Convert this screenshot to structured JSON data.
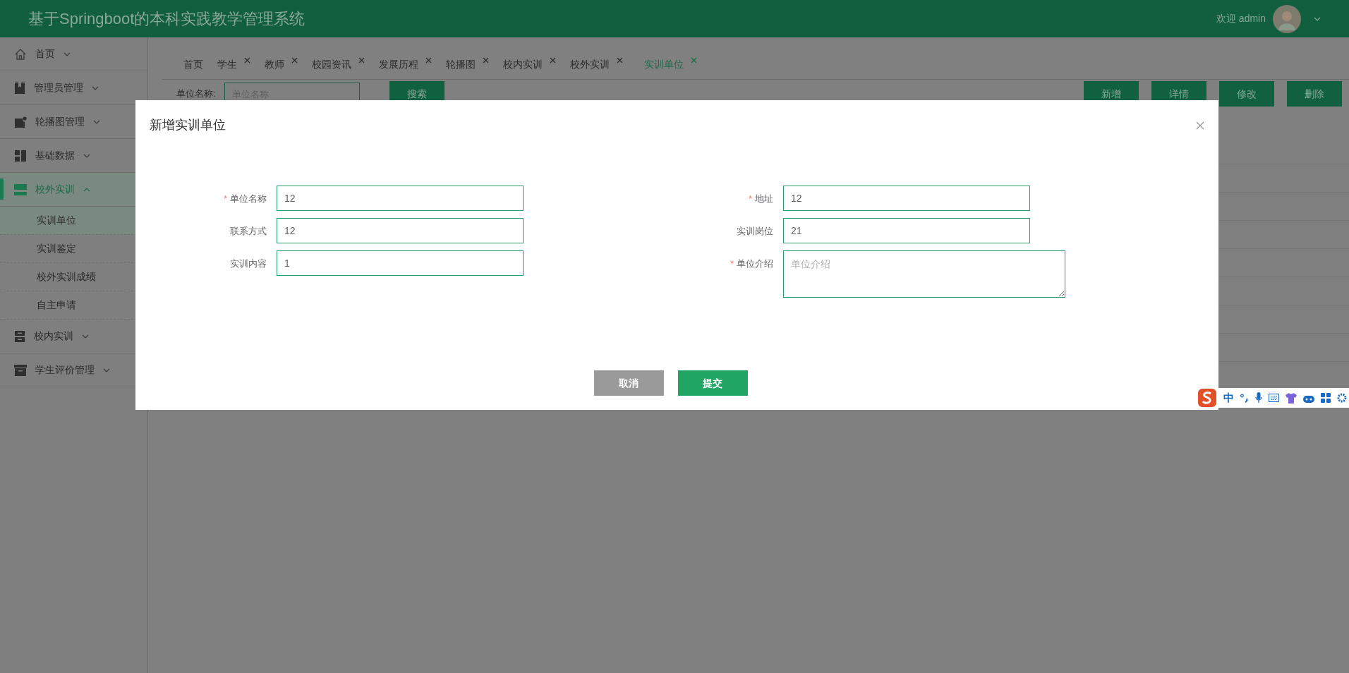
{
  "header": {
    "title": "基于Springboot的本科实践教学管理系统",
    "welcome": "欢迎 admin"
  },
  "sidebar": {
    "items": [
      {
        "label": "首页",
        "expanded": false,
        "selected": false
      },
      {
        "label": "管理员管理",
        "expanded": false,
        "selected": false
      },
      {
        "label": "轮播图管理",
        "expanded": false,
        "selected": false
      },
      {
        "label": "基础数据",
        "expanded": false,
        "selected": false
      },
      {
        "label": "校外实训",
        "expanded": true,
        "selected": true,
        "children": [
          {
            "label": "实训单位",
            "selected": true
          },
          {
            "label": "实训鉴定",
            "selected": false
          },
          {
            "label": "校外实训成绩",
            "selected": false
          },
          {
            "label": "自主申请",
            "selected": false
          }
        ]
      },
      {
        "label": "校内实训",
        "expanded": false,
        "selected": false
      },
      {
        "label": "学生评价管理",
        "expanded": false,
        "selected": false
      }
    ]
  },
  "tabs": [
    {
      "label": "首页",
      "closable": false,
      "selected": false
    },
    {
      "label": "学生",
      "closable": true,
      "selected": false
    },
    {
      "label": "教师",
      "closable": true,
      "selected": false
    },
    {
      "label": "校园资讯",
      "closable": true,
      "selected": false
    },
    {
      "label": "发展历程",
      "closable": true,
      "selected": false
    },
    {
      "label": "轮播图",
      "closable": true,
      "selected": false
    },
    {
      "label": "校内实训",
      "closable": true,
      "selected": false
    },
    {
      "label": "校外实训",
      "closable": true,
      "selected": false
    },
    {
      "label": "实训单位",
      "closable": true,
      "selected": true
    }
  ],
  "search": {
    "label": "单位名称:",
    "placeholder": "单位名称",
    "button": "搜索"
  },
  "actions": [
    "新增",
    "详情",
    "修改",
    "删除"
  ],
  "dialog": {
    "title": "新增实训单位",
    "left_fields": [
      {
        "label": "单位名称",
        "marker": "*",
        "kind": "input",
        "value": "12"
      },
      {
        "label": "联系方式",
        "kind": "input",
        "value": "12"
      },
      {
        "label": "实训内容",
        "kind": "input",
        "value": "1"
      }
    ],
    "right_fields": [
      {
        "label": "地址",
        "marker": "*",
        "kind": "input",
        "value": "12"
      },
      {
        "label": "实训岗位",
        "kind": "input",
        "value": "21"
      },
      {
        "label": "单位介绍",
        "marker": "*",
        "kind": "textarea",
        "placeholder": "单位介绍"
      }
    ],
    "cancel": "取消",
    "submit": "提交"
  },
  "ime_toolbar": {
    "mode": "中"
  }
}
